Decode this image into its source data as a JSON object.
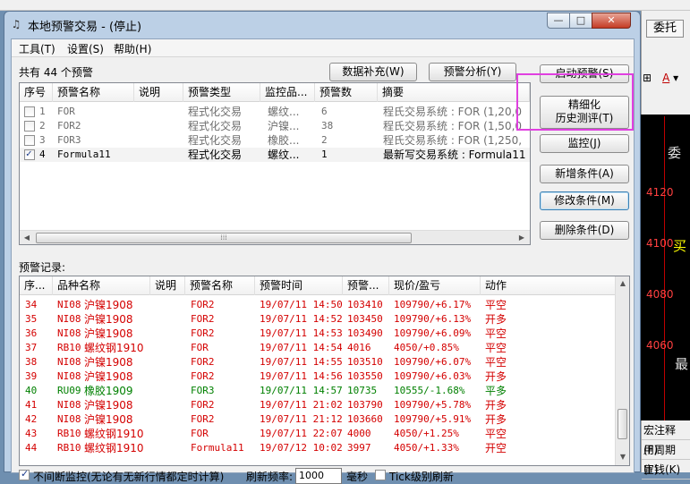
{
  "background_app": {
    "top_button": "委托",
    "format_a": "A",
    "labels": [
      "委",
      "买",
      "最"
    ],
    "prices": [
      "4120",
      "4100",
      "4080",
      "4060"
    ],
    "bottom_items": [
      "宏注释(F)",
      "用周期(F)",
      "宣钱(K)"
    ]
  },
  "window": {
    "title": "本地预警交易 - (停止)",
    "buttons": {
      "minimize": "—",
      "maximize": "□",
      "close": "✕"
    }
  },
  "menu": [
    "工具(T)",
    "设置(S)",
    "帮助(H)"
  ],
  "summary": "共有 44 个预警",
  "top_buttons": {
    "supplement": "数据补充(W)",
    "analysis": "预警分析(Y)"
  },
  "side_buttons": {
    "start": "启动预警(S)",
    "refine_line1": "精细化",
    "refine_line2": "历史测评(T)",
    "monitor": "监控(J)",
    "add": "新增条件(A)",
    "modify": "修改条件(M)",
    "delete": "删除条件(D)"
  },
  "warning_table": {
    "columns": [
      "序号",
      "预警名称",
      "说明",
      "预警类型",
      "监控品...",
      "预警数",
      "摘要"
    ],
    "rows": [
      {
        "checked": false,
        "no": "1",
        "name": "FOR",
        "desc": "",
        "type": "程式化交易",
        "product": "螺纹...",
        "count": "6",
        "summary": "程氏交易系统 : FOR (1,20,0"
      },
      {
        "checked": false,
        "no": "2",
        "name": "FOR2",
        "desc": "",
        "type": "程式化交易",
        "product": "沪镍...",
        "count": "38",
        "summary": "程氏交易系统 : FOR (1,50,0"
      },
      {
        "checked": false,
        "no": "3",
        "name": "FOR3",
        "desc": "",
        "type": "程式化交易",
        "product": "橡胶...",
        "count": "2",
        "summary": "程氏交易系统 : FOR (1,250,"
      },
      {
        "checked": true,
        "no": "4",
        "name": "Formula11",
        "desc": "",
        "type": "程式化交易",
        "product": "螺纹...",
        "count": "1",
        "summary": "最新写交易系统 : Formula11"
      }
    ]
  },
  "log_label": "预警记录:",
  "log_table": {
    "columns": [
      "序...",
      "品种名称",
      "说明",
      "预警名称",
      "预警时间",
      "预警...",
      "现价/盈亏",
      "动作"
    ],
    "rows": [
      {
        "no": "34",
        "code": "NI08",
        "prod": "沪镍1908",
        "desc": "",
        "name": "FOR2",
        "time": "19/07/11 14:50",
        "price": "103410",
        "pnl": "109790/+6.17%",
        "action": "平空",
        "color": "#d40000"
      },
      {
        "no": "35",
        "code": "NI08",
        "prod": "沪镍1908",
        "desc": "",
        "name": "FOR2",
        "time": "19/07/11 14:52",
        "price": "103450",
        "pnl": "109790/+6.13%",
        "action": "开多",
        "color": "#d40000"
      },
      {
        "no": "36",
        "code": "NI08",
        "prod": "沪镍1908",
        "desc": "",
        "name": "FOR2",
        "time": "19/07/11 14:53",
        "price": "103490",
        "pnl": "109790/+6.09%",
        "action": "平空",
        "color": "#d40000"
      },
      {
        "no": "37",
        "code": "RB10",
        "prod": "螺纹钢1910",
        "desc": "",
        "name": "FOR",
        "time": "19/07/11 14:54",
        "price": "4016",
        "pnl": "4050/+0.85%",
        "action": "平空",
        "color": "#d40000"
      },
      {
        "no": "38",
        "code": "NI08",
        "prod": "沪镍1908",
        "desc": "",
        "name": "FOR2",
        "time": "19/07/11 14:55",
        "price": "103510",
        "pnl": "109790/+6.07%",
        "action": "平空",
        "color": "#d40000"
      },
      {
        "no": "39",
        "code": "NI08",
        "prod": "沪镍1908",
        "desc": "",
        "name": "FOR2",
        "time": "19/07/11 14:56",
        "price": "103550",
        "pnl": "109790/+6.03%",
        "action": "开多",
        "color": "#d40000"
      },
      {
        "no": "40",
        "code": "RU09",
        "prod": "橡胶1909",
        "desc": "",
        "name": "FOR3",
        "time": "19/07/11 14:57",
        "price": "10735",
        "pnl": "10555/-1.68%",
        "action": "平多",
        "color": "#008000"
      },
      {
        "no": "41",
        "code": "NI08",
        "prod": "沪镍1908",
        "desc": "",
        "name": "FOR2",
        "time": "19/07/11 21:02",
        "price": "103790",
        "pnl": "109790/+5.78%",
        "action": "开多",
        "color": "#d40000"
      },
      {
        "no": "42",
        "code": "NI08",
        "prod": "沪镍1908",
        "desc": "",
        "name": "FOR2",
        "time": "19/07/11 21:12",
        "price": "103660",
        "pnl": "109790/+5.91%",
        "action": "开多",
        "color": "#d40000"
      },
      {
        "no": "43",
        "code": "RB10",
        "prod": "螺纹钢1910",
        "desc": "",
        "name": "FOR",
        "time": "19/07/11 22:07",
        "price": "4000",
        "pnl": "4050/+1.25%",
        "action": "平空",
        "color": "#d40000"
      },
      {
        "no": "44",
        "code": "RB10",
        "prod": "螺纹钢1910",
        "desc": "",
        "name": "Formula11",
        "time": "19/07/12 10:02",
        "price": "3997",
        "pnl": "4050/+1.33%",
        "action": "开空",
        "color": "#d40000"
      }
    ]
  },
  "footer": {
    "continuous_monitor": "不间断监控(无论有无新行情都定时计算)",
    "refresh_label": "刷新频率:",
    "refresh_value": "1000",
    "unit": "毫秒",
    "tick_label": "Tick级别刷新",
    "continuous_checked": true,
    "tick_checked": false
  }
}
